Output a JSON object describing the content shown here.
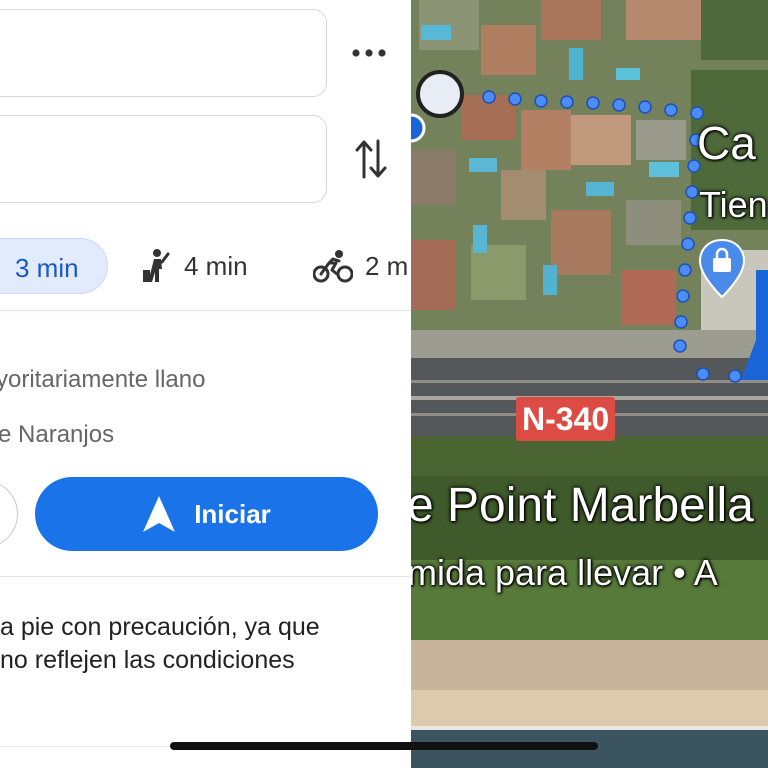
{
  "directions": {
    "origin_value": "",
    "destination_value": "",
    "modes": [
      {
        "icon": "car-icon",
        "time": "3 min",
        "selected": true
      },
      {
        "icon": "transit-icon",
        "time": "4 min",
        "selected": false
      },
      {
        "icon": "bike-icon",
        "time": "2 m",
        "selected": false
      }
    ],
    "route_description": "yoritariamente llano",
    "route_via": "e Naranjos",
    "start_label": "Iniciar",
    "warning_line1": "a pie con precaución, ya que",
    "warning_line2": "no reflejen las condiciones"
  },
  "map": {
    "place_name": "Ca",
    "place_category": "Tien",
    "road_label": "N-340",
    "poi_name": "e Point Marbella",
    "poi_description": "mida para llevar • A"
  },
  "colors": {
    "accent": "#1a73e8",
    "selected_chip": "#e2ebfc",
    "route_dots": "#4b8cf5",
    "road_badge": "#dd4b45"
  }
}
